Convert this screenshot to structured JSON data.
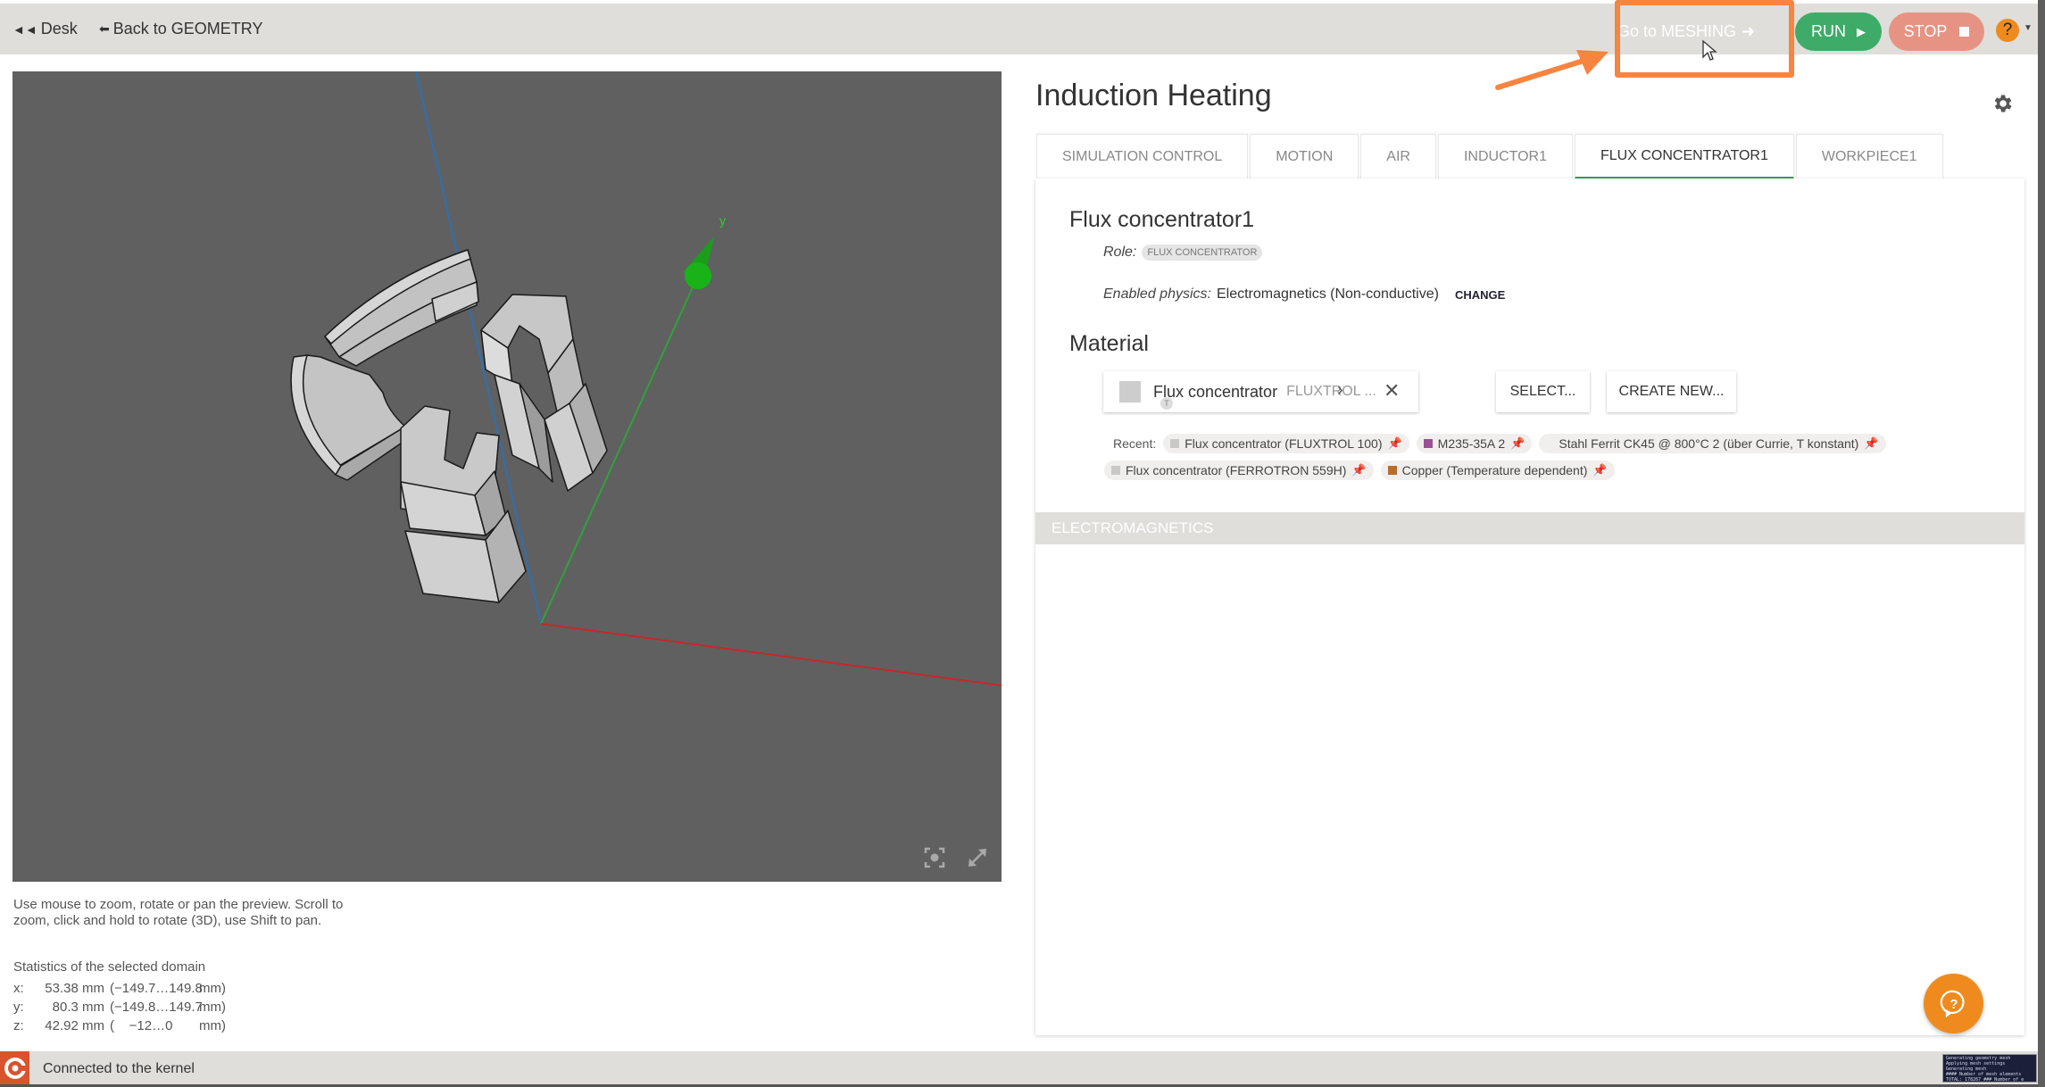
{
  "topbar": {
    "desk_label": "Desk",
    "back_label": "Back to GEOMETRY",
    "meshing_label": "Go to MESHING",
    "run_label": "RUN",
    "stop_label": "STOP",
    "help_label": "?"
  },
  "colors": {
    "run": "#3eac68",
    "stop": "#e79384",
    "accent_orange": "#ef8b1e",
    "annotation": "#f7843f",
    "active_tab_underline": "#3e9c5d",
    "axis_x": "#c8262a",
    "axis_y": "#2fa33a",
    "axis_z": "#2f6fb0"
  },
  "viewport": {
    "axis_label_y": "y",
    "help_text": "Use mouse to zoom, rotate or pan the preview. Scroll to zoom, click and hold to rotate (3D), use Shift to pan.",
    "stats_title": "Statistics of the selected domain",
    "stats": [
      {
        "axis": "x:",
        "value": "53.38 mm",
        "range": "(−149.7…149.8",
        "unit": "mm)"
      },
      {
        "axis": "y:",
        "value": "80.3 mm",
        "range": "(−149.8…149.7",
        "unit": "mm)"
      },
      {
        "axis": "z:",
        "value": "42.92 mm",
        "range": "(    −12…0",
        "unit": "mm)"
      }
    ]
  },
  "status": {
    "text": "Connected to the kernel",
    "console_lines": [
      "Generating geometry mesh",
      "Applying mesh settings",
      "Generating mesh",
      "#### Number of mesh elements",
      "TOTAL: 178267 ### Number of e"
    ]
  },
  "main": {
    "title": "Induction Heating",
    "tabs": [
      {
        "label": "SIMULATION CONTROL",
        "active": false
      },
      {
        "label": "MOTION",
        "active": false
      },
      {
        "label": "AIR",
        "active": false
      },
      {
        "label": "INDUCTOR1",
        "active": false
      },
      {
        "label": "FLUX CONCENTRATOR1",
        "active": true
      },
      {
        "label": "WORKPIECE1",
        "active": false
      }
    ],
    "domain_name": "Flux concentrator1",
    "role_label": "Role:",
    "role_value": "FLUX CONCENTRATOR",
    "physics_label": "Enabled physics:",
    "physics_value": "Electromagnetics (Non-conductive)",
    "change_label": "CHANGE",
    "material_heading": "Material",
    "material": {
      "name": "Flux concentrator",
      "sub": "FLUXTROL ...",
      "badge": "T",
      "swatch": "#cdcdcd"
    },
    "select_label": "SELECT...",
    "create_label": "CREATE NEW...",
    "recent_label": "Recent:",
    "recent": [
      {
        "label": "Flux concentrator (FLUXTROL 100)",
        "color": "#c8c8c8"
      },
      {
        "label": "M235-35A 2",
        "color": "#9b4f96"
      },
      {
        "label": "Stahl Ferrit CK45 @ 800°C 2 (über Currie, T konstant)",
        "color": ""
      },
      {
        "label": "Flux concentrator (FERROTRON 559H)",
        "color": "#c8c8c8"
      },
      {
        "label": "Copper (Temperature dependent)",
        "color": "#b86b2b"
      }
    ],
    "section_electromagnetics": "ELECTROMAGNETICS"
  }
}
